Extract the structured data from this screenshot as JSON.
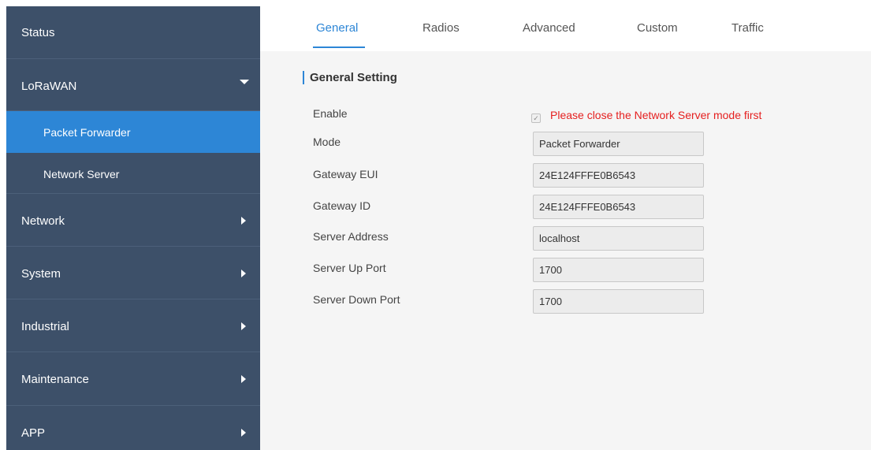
{
  "sidebar": {
    "items": [
      {
        "label": "Status"
      },
      {
        "label": "LoRaWAN"
      },
      {
        "label": "Network"
      },
      {
        "label": "System"
      },
      {
        "label": "Industrial"
      },
      {
        "label": "Maintenance"
      },
      {
        "label": "APP"
      }
    ],
    "subitems": [
      {
        "label": "Packet Forwarder",
        "active": true
      },
      {
        "label": "Network Server",
        "active": false
      }
    ]
  },
  "tabs": [
    {
      "label": "General",
      "active": true
    },
    {
      "label": "Radios"
    },
    {
      "label": "Advanced"
    },
    {
      "label": "Custom"
    },
    {
      "label": "Traffic"
    }
  ],
  "general_setting": {
    "title": "General Setting",
    "enable_label": "Enable",
    "enable_checked": true,
    "warning": "Please close the Network Server mode first",
    "fields": [
      {
        "label": "Mode",
        "value": "Packet Forwarder"
      },
      {
        "label": "Gateway EUI",
        "value": "24E124FFFE0B6543"
      },
      {
        "label": "Gateway ID",
        "value": "24E124FFFE0B6543"
      },
      {
        "label": "Server Address",
        "value": "localhost"
      },
      {
        "label": "Server Up Port",
        "value": "1700"
      },
      {
        "label": "Server Down Port",
        "value": "1700"
      }
    ]
  },
  "colors": {
    "sidebar_bg": "#3d5069",
    "accent": "#2d86d6",
    "warning": "#e52020"
  }
}
